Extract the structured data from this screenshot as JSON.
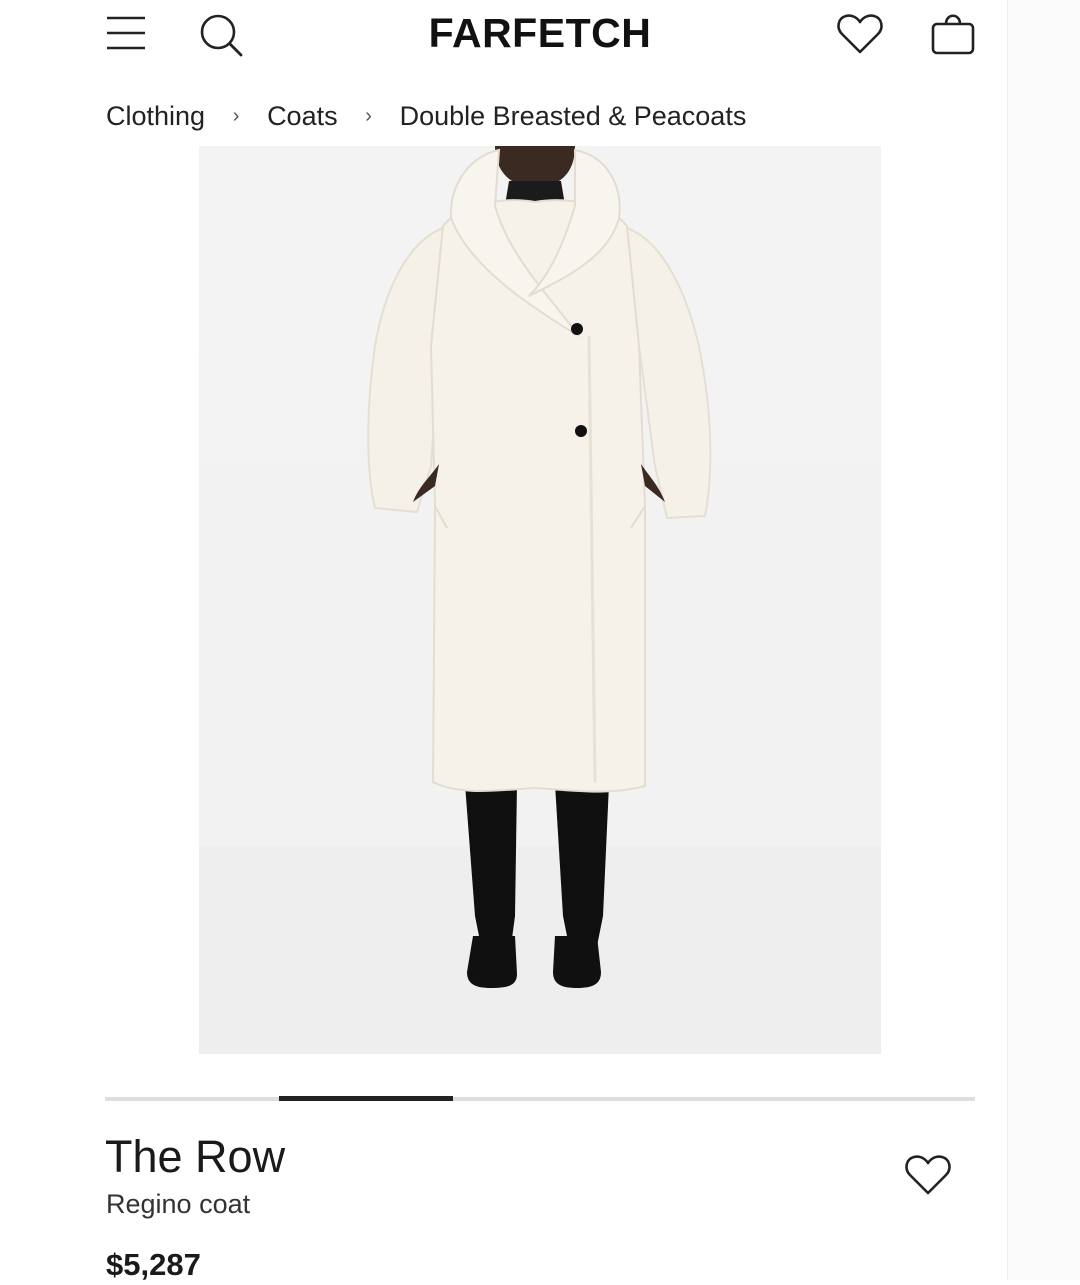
{
  "header": {
    "logo": "FARFETCH",
    "icons": [
      "menu-icon",
      "search-icon",
      "heart-icon",
      "shopping-bag-icon"
    ]
  },
  "breadcrumb": {
    "items": [
      "Clothing",
      "Coats",
      "Double Breasted & Peacoats"
    ],
    "separator": "›"
  },
  "gallery": {
    "image_subject": "white shawl-collar coat",
    "active_slide": 2,
    "total_slides": 5
  },
  "product": {
    "brand": "The Row",
    "name": "Regino coat",
    "price": "$5,287"
  },
  "colors": {
    "text": "#1a1a1a",
    "coat": "#f6f2e9",
    "background": "#f2f2f2"
  }
}
